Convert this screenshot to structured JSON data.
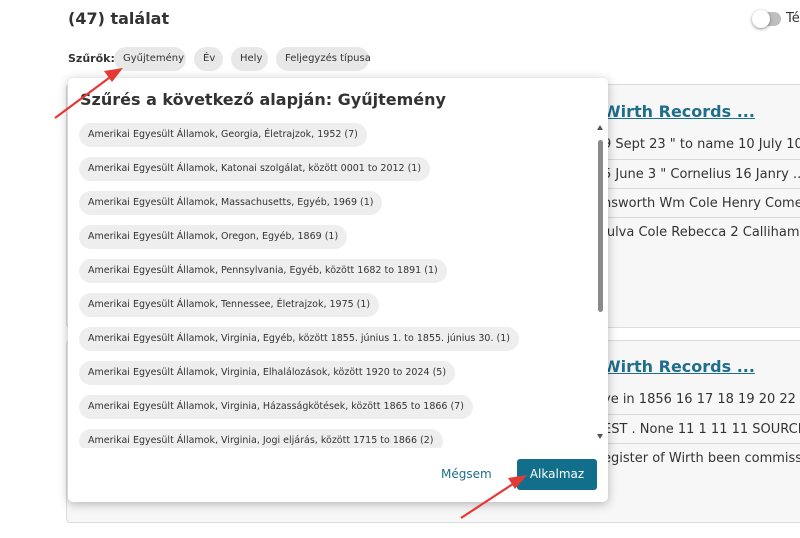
{
  "header": {
    "results_count": "(47) találat",
    "toggle_label": "Té"
  },
  "filters": {
    "label": "Szűrők:",
    "chips": [
      "Gyűjtemény",
      "Év",
      "Hely",
      "Feljegyzés típusa"
    ]
  },
  "background_cards": [
    {
      "title": "Wirth Records ...",
      "lines": [
        "9 Sept 23 \" to name 10 July 10...",
        "5 June 3 \" Cornelius 16 Janry ...",
        "nsworth Wm Cole Henry Come ...",
        "Julva Cole Rebecca 2 Calliham Ma"
      ]
    },
    {
      "title": "Wirth Records ...",
      "lines": [
        "ye in 1856 16 17 18 19 20 22 FATH",
        "EST . None 11 1 11 11 SOURCES O",
        "egister of Wirth been commission"
      ]
    }
  ],
  "modal": {
    "title": "Szűrés a következő alapján: Gyűjtemény",
    "options": [
      "Amerikai Egyesült Államok, Georgia, Életrajzok, 1952 (7)",
      "Amerikai Egyesült Államok, Katonai szolgálat, között 0001 to 2012 (1)",
      "Amerikai Egyesült Államok, Massachusetts, Egyéb, 1969 (1)",
      "Amerikai Egyesült Államok, Oregon, Egyéb, 1869 (1)",
      "Amerikai Egyesült Államok, Pennsylvania, Egyéb, között 1682 to 1891 (1)",
      "Amerikai Egyesült Államok, Tennessee, Életrajzok, 1975 (1)",
      "Amerikai Egyesült Államok, Virginia, Egyéb, között 1855. június 1. to 1855. június 30. (1)",
      "Amerikai Egyesült Államok, Virginia, Elhalálozások, között 1920 to 2024 (5)",
      "Amerikai Egyesült Államok, Virginia, Házasságkötések, között 1865 to 1866 (7)",
      "Amerikai Egyesült Államok, Virginia, Jogi eljárás, között 1715 to 1866 (2)"
    ],
    "cancel_label": "Mégsem",
    "apply_label": "Alkalmaz"
  },
  "colors": {
    "accent": "#126f8c",
    "link": "#1e6e8c",
    "annotation_arrow": "#e53935"
  }
}
